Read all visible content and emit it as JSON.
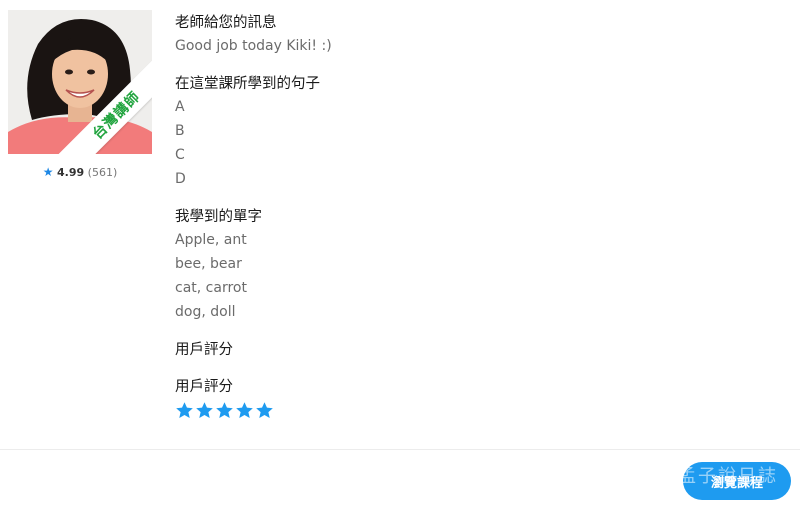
{
  "teacher": {
    "badge": "台灣講師",
    "rating": "4.99",
    "review_count": "(561)"
  },
  "message": {
    "title": "老師給您的訊息",
    "text": "Good job today Kiki! :)"
  },
  "sentences": {
    "title": "在這堂課所學到的句子",
    "items": [
      "A",
      "B",
      "C",
      "D"
    ]
  },
  "vocabulary": {
    "title": "我學到的單字",
    "items": [
      "Apple, ant",
      "bee, bear",
      "cat, carrot",
      "dog, doll"
    ]
  },
  "user_rating_1": {
    "title": "用戶評分"
  },
  "user_rating_2": {
    "title": "用戶評分",
    "stars": 5,
    "max_stars": 5
  },
  "footer": {
    "browse_button": "瀏覽課程",
    "watermark": "孟子說日誌"
  },
  "colors": {
    "accent": "#1e9bf0",
    "star": "#1e9bf0",
    "badge_green": "#21a43f"
  }
}
